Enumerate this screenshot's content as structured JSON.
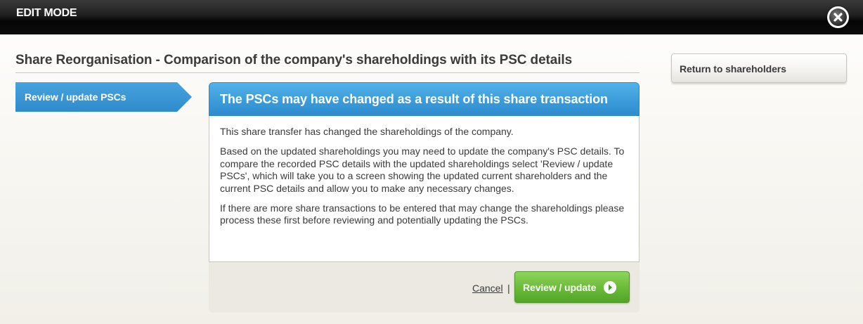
{
  "header": {
    "title": "EDIT MODE",
    "close_icon": "close-icon"
  },
  "page": {
    "title": "Share Reorganisation - Comparison of the company's shareholdings with its PSC details"
  },
  "steps": [
    {
      "label": "Review / update PSCs",
      "active": true
    }
  ],
  "sidebar": {
    "return_label": "Return to shareholders"
  },
  "panel": {
    "heading": "The PSCs may have changed as a result of this share transaction",
    "paragraphs": [
      "This share transfer has changed the shareholdings of the company.",
      "Based on the updated shareholdings you may need to update the company's PSC details. To compare the recorded PSC details with the updated shareholdings select 'Review / update PSCs', which will take you to a screen showing the updated current shareholders and the current PSC details and allow you to make any necessary changes.",
      "If there are more share transactions to be entered that may change the shareholdings please process these first before reviewing and potentially updating the PSCs."
    ],
    "cancel_label": "Cancel",
    "separator": "|",
    "primary_label": "Review / update",
    "primary_icon": "arrow-right-circle-icon"
  },
  "colors": {
    "accent_blue": "#3a9ad9",
    "primary_green": "#6dbd3b",
    "topbar": "#111111"
  }
}
